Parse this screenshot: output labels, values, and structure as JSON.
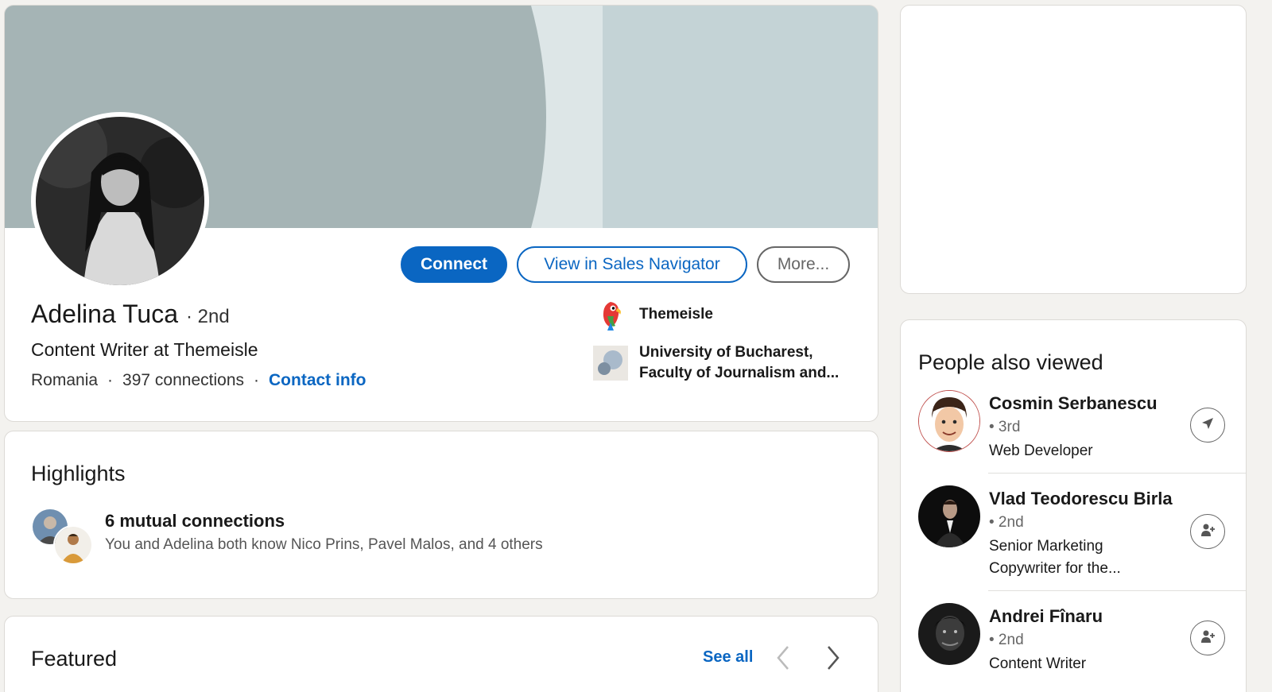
{
  "profile": {
    "name": "Adelina Tuca",
    "degree": "· 2nd",
    "headline": "Content Writer at Themeisle",
    "location": "Romania",
    "separator": "·",
    "connections": "397 connections",
    "contact_info": "Contact info",
    "actions": {
      "connect": "Connect",
      "sales_navigator": "View in Sales Navigator",
      "more": "More..."
    },
    "company": {
      "name": "Themeisle",
      "icon": "parrot-logo"
    },
    "school": {
      "name_line1": "University of Bucharest,",
      "name_line2": "Faculty of Journalism and...",
      "icon": "school-logo"
    }
  },
  "highlights": {
    "title": "Highlights",
    "mutual_title": "6 mutual connections",
    "mutual_sub": "You and Adelina both know Nico Prins, Pavel Malos, and 4 others"
  },
  "featured": {
    "title": "Featured",
    "see_all": "See all"
  },
  "people_also_viewed": {
    "title": "People also viewed",
    "people": [
      {
        "name": "Cosmin Serbanescu",
        "degree": "• 3rd",
        "title": "Web Developer",
        "action_icon": "send-icon"
      },
      {
        "name": "Vlad Teodorescu Birla",
        "degree": "• 2nd",
        "title": "Senior Marketing Copywriter for the...",
        "action_icon": "connect-icon"
      },
      {
        "name": "Andrei Fînaru",
        "degree": "• 2nd",
        "title": "Content Writer",
        "action_icon": "connect-icon"
      }
    ]
  },
  "colors": {
    "accent": "#0a66c2",
    "background": "#f3f2ef",
    "cover_dark": "#a5b4b5",
    "cover_light": "#c4d3d6"
  }
}
